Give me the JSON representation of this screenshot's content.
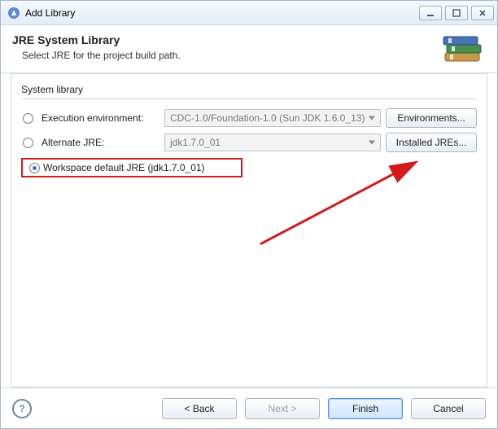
{
  "window": {
    "title": "Add Library"
  },
  "header": {
    "title": "JRE System Library",
    "subtitle": "Select JRE for the project build path."
  },
  "group": {
    "title": "System library"
  },
  "options": {
    "exec_env": {
      "label": "Execution environment:",
      "value": "CDC-1.0/Foundation-1.0 (Sun JDK 1.6.0_13)",
      "button": "Environments..."
    },
    "alternate": {
      "label": "Alternate JRE:",
      "value": "jdk1.7.0_01",
      "button": "Installed JREs..."
    },
    "workspace": {
      "label": "Workspace default JRE (jdk1.7.0_01)"
    }
  },
  "footer": {
    "back": "< Back",
    "next": "Next >",
    "finish": "Finish",
    "cancel": "Cancel"
  },
  "help_glyph": "?"
}
